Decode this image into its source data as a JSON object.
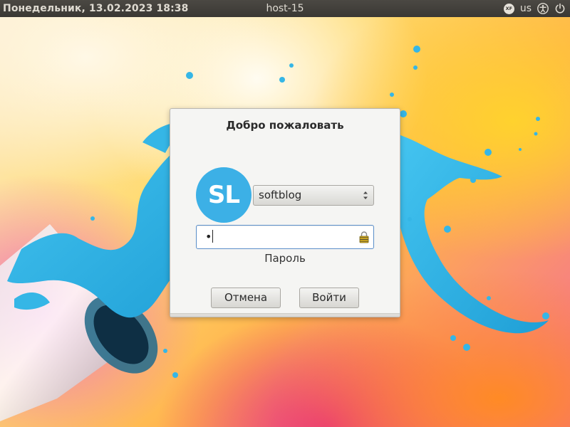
{
  "top_panel": {
    "datetime": "Понедельник, 13.02.2023 18:38",
    "hostname": "host-15",
    "indicators": {
      "xf_badge": "XF",
      "keyboard_layout": "us",
      "accessibility_icon": "accessibility-icon",
      "power_icon": "power-icon"
    }
  },
  "login_dialog": {
    "title": "Добро пожаловать",
    "avatar_initials": "SL",
    "username": "softblog",
    "password_value": "•",
    "password_label": "Пароль",
    "cancel_label": "Отмена",
    "login_label": "Войти",
    "caps_lock_icon": "caps-lock-warning-icon"
  },
  "colors": {
    "panel_bg": "#3a3834",
    "paint_blue": "#35b6e6",
    "avatar_bg": "#3cb0e6",
    "focus_border": "#5a8ec9"
  }
}
